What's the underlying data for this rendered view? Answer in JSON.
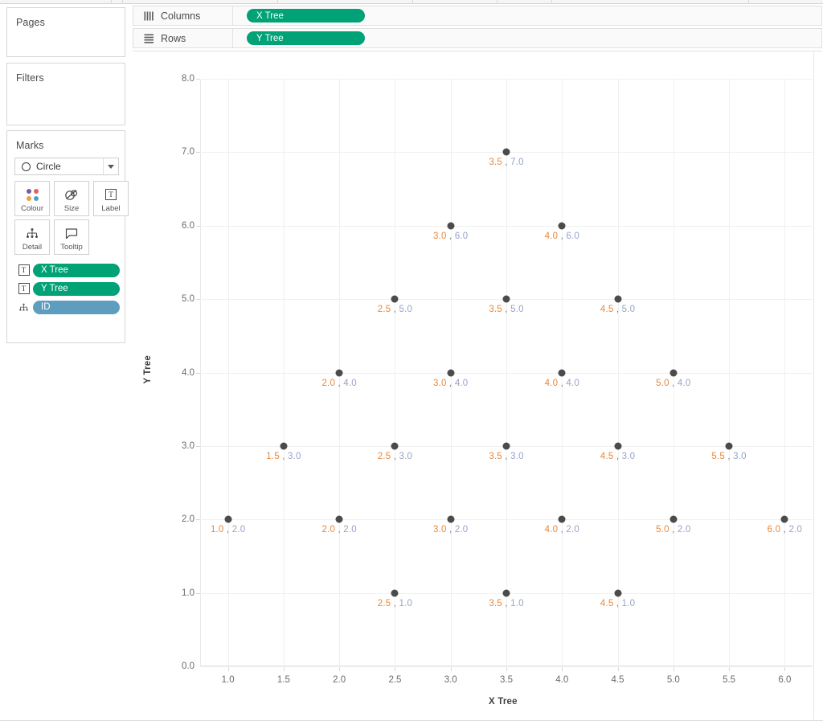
{
  "left_panel": {
    "pages": {
      "title": "Pages"
    },
    "filters": {
      "title": "Filters"
    },
    "marks": {
      "title": "Marks",
      "mark_type": "Circle",
      "mark_type_icon": "circle-icon",
      "dropdown_icon": "chevron-down-icon",
      "properties": [
        {
          "label": "Colour",
          "icon": "colour-dots-icon"
        },
        {
          "label": "Size",
          "icon": "size-overlap-icon"
        },
        {
          "label": "Label",
          "icon": "label-text-icon"
        },
        {
          "label": "Detail",
          "icon": "detail-hierarchy-icon"
        },
        {
          "label": "Tooltip",
          "icon": "tooltip-bubble-icon"
        }
      ],
      "pills": [
        {
          "label": "X Tree",
          "icon": "label-text-icon",
          "colour": "#00a276",
          "kind": "green"
        },
        {
          "label": "Y Tree",
          "icon": "label-text-icon",
          "colour": "#00a276",
          "kind": "green"
        },
        {
          "label": "ID",
          "icon": "detail-hierarchy-icon",
          "colour": "#5f9dbf",
          "kind": "blue"
        }
      ]
    }
  },
  "shelves": {
    "columns": {
      "label": "Columns",
      "icon": "columns-icon",
      "pill": "X Tree",
      "pill_colour": "#00a276"
    },
    "rows": {
      "label": "Rows",
      "icon": "rows-icon",
      "pill": "Y Tree",
      "pill_colour": "#00a276"
    }
  },
  "chart_data": {
    "type": "scatter",
    "title": "",
    "xlabel": "X Tree",
    "ylabel": "Y Tree",
    "xlim": [
      0.75,
      6.25
    ],
    "ylim": [
      0.0,
      8.0
    ],
    "grid": true,
    "legend": null,
    "xticks": [
      "1.0",
      "1.5",
      "2.0",
      "2.5",
      "3.0",
      "3.5",
      "4.0",
      "4.5",
      "5.0",
      "5.5",
      "6.0"
    ],
    "xtick_values": [
      1.0,
      1.5,
      2.0,
      2.5,
      3.0,
      3.5,
      4.0,
      4.5,
      5.0,
      5.5,
      6.0
    ],
    "yticks": [
      "0.0",
      "1.0",
      "2.0",
      "3.0",
      "4.0",
      "5.0",
      "6.0",
      "7.0",
      "8.0"
    ],
    "ytick_values": [
      0,
      1,
      2,
      3,
      4,
      5,
      6,
      7,
      8
    ],
    "mark_colour": "#4b4b4b",
    "label_x_colour": "#e8883a",
    "label_y_colour": "#96a3c9",
    "points": [
      {
        "x": 3.5,
        "y": 7.0,
        "label_x": "3.5",
        "label_y": "7.0"
      },
      {
        "x": 3.0,
        "y": 6.0,
        "label_x": "3.0",
        "label_y": "6.0"
      },
      {
        "x": 4.0,
        "y": 6.0,
        "label_x": "4.0",
        "label_y": "6.0"
      },
      {
        "x": 2.5,
        "y": 5.0,
        "label_x": "2.5",
        "label_y": "5.0"
      },
      {
        "x": 3.5,
        "y": 5.0,
        "label_x": "3.5",
        "label_y": "5.0"
      },
      {
        "x": 4.5,
        "y": 5.0,
        "label_x": "4.5",
        "label_y": "5.0"
      },
      {
        "x": 2.0,
        "y": 4.0,
        "label_x": "2.0",
        "label_y": "4.0"
      },
      {
        "x": 3.0,
        "y": 4.0,
        "label_x": "3.0",
        "label_y": "4.0"
      },
      {
        "x": 4.0,
        "y": 4.0,
        "label_x": "4.0",
        "label_y": "4.0"
      },
      {
        "x": 5.0,
        "y": 4.0,
        "label_x": "5.0",
        "label_y": "4.0"
      },
      {
        "x": 1.5,
        "y": 3.0,
        "label_x": "1.5",
        "label_y": "3.0"
      },
      {
        "x": 2.5,
        "y": 3.0,
        "label_x": "2.5",
        "label_y": "3.0"
      },
      {
        "x": 3.5,
        "y": 3.0,
        "label_x": "3.5",
        "label_y": "3.0"
      },
      {
        "x": 4.5,
        "y": 3.0,
        "label_x": "4.5",
        "label_y": "3.0"
      },
      {
        "x": 5.5,
        "y": 3.0,
        "label_x": "5.5",
        "label_y": "3.0"
      },
      {
        "x": 1.0,
        "y": 2.0,
        "label_x": "1.0",
        "label_y": "2.0"
      },
      {
        "x": 2.0,
        "y": 2.0,
        "label_x": "2.0",
        "label_y": "2.0"
      },
      {
        "x": 3.0,
        "y": 2.0,
        "label_x": "3.0",
        "label_y": "2.0"
      },
      {
        "x": 4.0,
        "y": 2.0,
        "label_x": "4.0",
        "label_y": "2.0"
      },
      {
        "x": 5.0,
        "y": 2.0,
        "label_x": "5.0",
        "label_y": "2.0"
      },
      {
        "x": 6.0,
        "y": 2.0,
        "label_x": "6.0",
        "label_y": "2.0"
      },
      {
        "x": 2.5,
        "y": 1.0,
        "label_x": "2.5",
        "label_y": "1.0"
      },
      {
        "x": 3.5,
        "y": 1.0,
        "label_x": "3.5",
        "label_y": "1.0"
      },
      {
        "x": 4.5,
        "y": 1.0,
        "label_x": "4.5",
        "label_y": "1.0"
      }
    ]
  }
}
